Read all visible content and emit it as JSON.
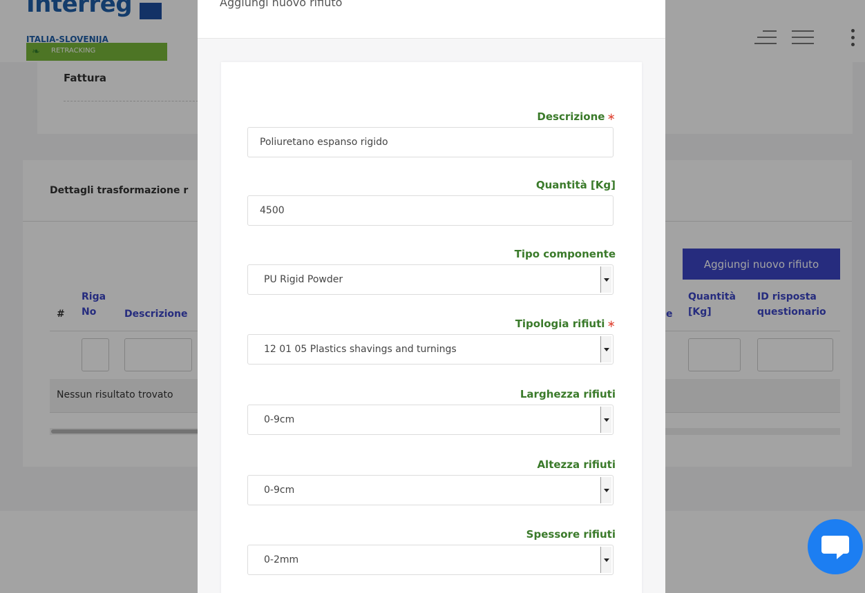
{
  "brand": {
    "name": "Interreg",
    "country": "ITALIA-SLOVENIJA",
    "project": "RETRACKING"
  },
  "background": {
    "section_title": "Fattura",
    "details_title": "Dettagli trasformazione r",
    "add_button": "Aggiungi nuovo rifiuto",
    "table": {
      "columns": [
        "#",
        "Riga\nNo",
        "Descrizione",
        "e",
        "Quantità\n[Kg]",
        "ID risposta\nquestionario"
      ],
      "empty_message": "Nessun risultato trovato"
    }
  },
  "modal": {
    "title": "Aggiungi nuovo rifiuto",
    "fields": [
      {
        "label": "Descrizione",
        "required": true,
        "value": "Poliuretano espanso rigido",
        "type": "text"
      },
      {
        "label": "Quantità [Kg]",
        "required": false,
        "value": "4500",
        "type": "text"
      },
      {
        "label": "Tipo componente",
        "required": false,
        "value": "PU Rigid Powder",
        "type": "select"
      },
      {
        "label": "Tipologia rifiuti",
        "required": true,
        "value": "12 01 05 Plastics shavings and turnings",
        "type": "select"
      },
      {
        "label": "Larghezza rifiuti",
        "required": false,
        "value": "0-9cm",
        "type": "select"
      },
      {
        "label": "Altezza rifiuti",
        "required": false,
        "value": "0-9cm",
        "type": "select"
      },
      {
        "label": "Spessore rifiuti",
        "required": false,
        "value": "0-2mm",
        "type": "select"
      }
    ]
  },
  "colors": {
    "label_green": "#3a7a2a",
    "required_red": "#e04a3a",
    "primary_blue": "#3c46c6",
    "chat_blue": "#1c7ef2"
  },
  "icons": {
    "menu_1": "hamburger-icon",
    "menu_2": "hamburger-icon",
    "more": "kebab-icon",
    "chat": "chat-icon"
  }
}
